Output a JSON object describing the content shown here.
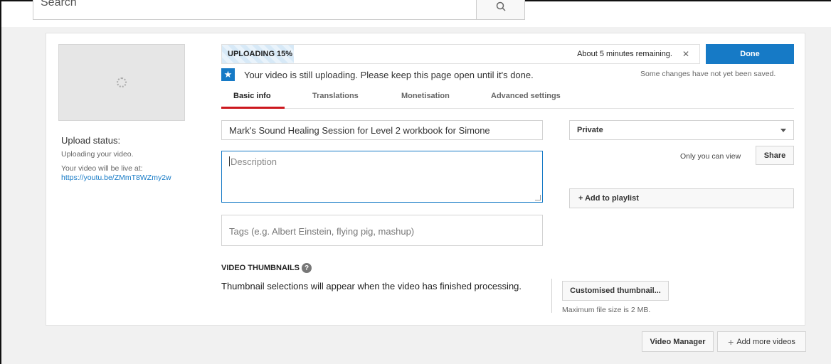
{
  "search": {
    "placeholder": "Search"
  },
  "upload": {
    "progress_label": "UPLOADING 15%",
    "progress_fraction": 0.15,
    "remaining": "About 5 minutes remaining.",
    "close_symbol": "✕",
    "done_label": "Done",
    "notice": "Your video is still uploading. Please keep this page open until it's done.",
    "unsaved": "Some changes have not yet been saved."
  },
  "tabs": [
    {
      "label": "Basic info",
      "active": true
    },
    {
      "label": "Translations",
      "active": false
    },
    {
      "label": "Monetisation",
      "active": false
    },
    {
      "label": "Advanced settings",
      "active": false
    }
  ],
  "status": {
    "title": "Upload status:",
    "line1": "Uploading your video.",
    "line2": "Your video will be live at:",
    "link": "https://youtu.be/ZMmT8WZmy2w"
  },
  "form": {
    "title_value": "Mark's Sound Healing Session for Level 2 workbook for Simone",
    "description_placeholder": "Description",
    "tags_placeholder": "Tags (e.g. Albert Einstein, flying pig, mashup)",
    "privacy": "Private",
    "privacy_note": "Only you can view",
    "share_label": "Share",
    "playlist_label": "+ Add to playlist"
  },
  "thumbnails": {
    "heading": "VIDEO THUMBNAILS",
    "help_symbol": "?",
    "text": "Thumbnail selections will appear when the video has finished processing.",
    "custom_button": "Customised thumbnail...",
    "max_size": "Maximum file size is 2 MB."
  },
  "footer": {
    "video_manager": "Video Manager",
    "add_more": "Add more videos",
    "plus_symbol": "+"
  },
  "colors": {
    "accent": "#167ac6",
    "tab_underline": "#cc181e"
  },
  "icons": [
    "search-icon",
    "star-icon",
    "close-icon",
    "help-icon",
    "chevron-down-icon",
    "plus-icon"
  ]
}
